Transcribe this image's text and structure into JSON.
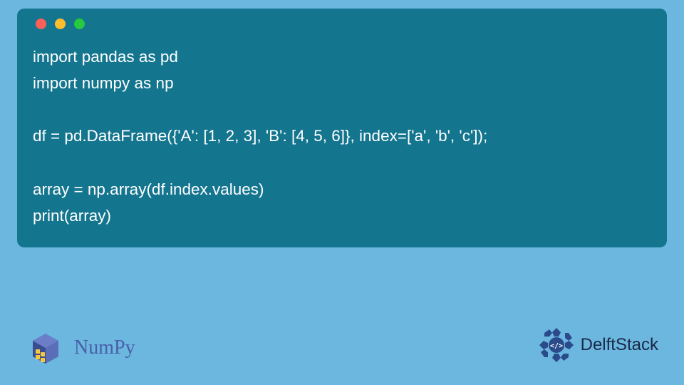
{
  "code": {
    "lines": [
      "import pandas as pd",
      "import numpy as np",
      "",
      "df = pd.DataFrame({'A': [1, 2, 3], 'B': [4, 5, 6]}, index=['a', 'b', 'c']);",
      "",
      "array = np.array(df.index.values)",
      "print(array)"
    ]
  },
  "footer": {
    "numpy_label": "NumPy",
    "delft_label": "DelftStack"
  },
  "colors": {
    "page_bg": "#6bb7e0",
    "card_bg": "#14758f",
    "dot_red": "#ff5f56",
    "dot_yellow": "#ffbd2e",
    "dot_green": "#27c93f",
    "numpy_text": "#4a5fa8",
    "delft_text": "#1a2845"
  }
}
